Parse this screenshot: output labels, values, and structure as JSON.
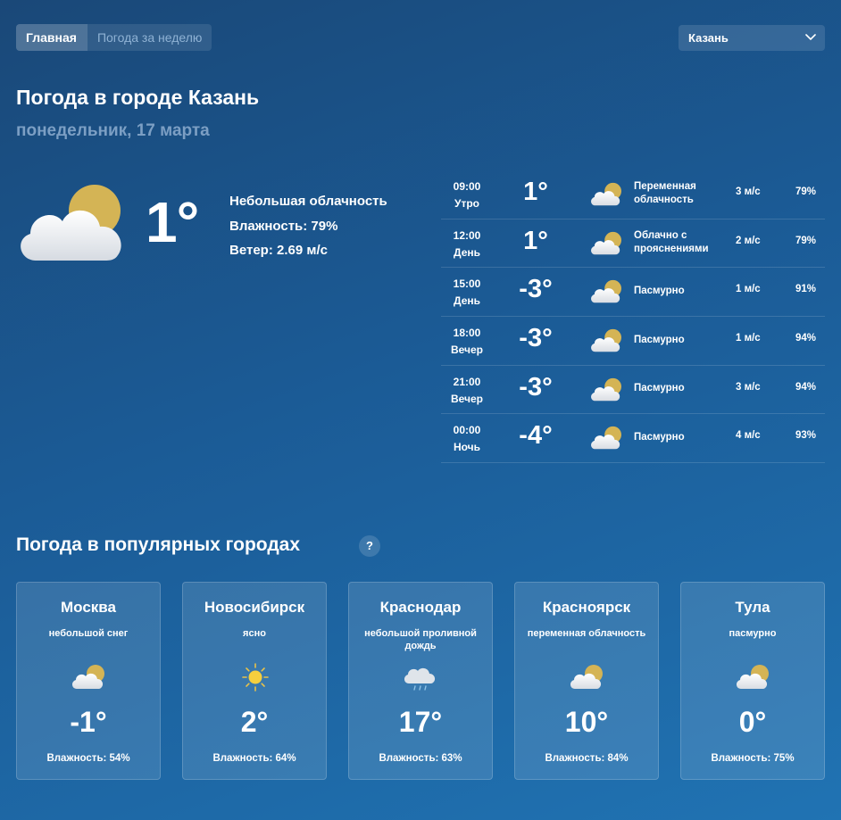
{
  "nav": {
    "tabs": [
      {
        "label": "Главная"
      },
      {
        "label": "Погода за неделю"
      }
    ]
  },
  "city_select": {
    "value": "Казань",
    "icon": "chevron-down-icon"
  },
  "header": {
    "title": "Погода в городе Казань",
    "date": "понедельник, 17 марта"
  },
  "current": {
    "icon": "partly-cloudy-icon",
    "temp": "1°",
    "condition": "Небольшая облачность",
    "humidity": "Влажность: 79%",
    "wind": "Ветер: 2.69 м/с"
  },
  "hourly": [
    {
      "time": "09:00",
      "period": "Утро",
      "temp": "1°",
      "icon": "partly-cloudy-icon",
      "condition": "Переменная облачность",
      "wind": "3 м/с",
      "humidity": "79%"
    },
    {
      "time": "12:00",
      "period": "День",
      "temp": "1°",
      "icon": "partly-cloudy-icon",
      "condition": "Облачно с прояснениями",
      "wind": "2 м/с",
      "humidity": "79%"
    },
    {
      "time": "15:00",
      "period": "День",
      "temp": "-3°",
      "icon": "partly-cloudy-icon",
      "condition": "Пасмурно",
      "wind": "1 м/с",
      "humidity": "91%"
    },
    {
      "time": "18:00",
      "period": "Вечер",
      "temp": "-3°",
      "icon": "partly-cloudy-icon",
      "condition": "Пасмурно",
      "wind": "1 м/с",
      "humidity": "94%"
    },
    {
      "time": "21:00",
      "period": "Вечер",
      "temp": "-3°",
      "icon": "partly-cloudy-icon",
      "condition": "Пасмурно",
      "wind": "3 м/с",
      "humidity": "94%"
    },
    {
      "time": "00:00",
      "period": "Ночь",
      "temp": "-4°",
      "icon": "partly-cloudy-icon",
      "condition": "Пасмурно",
      "wind": "4 м/с",
      "humidity": "93%"
    }
  ],
  "popular": {
    "title": "Погода в популярных городах",
    "help_label": "?",
    "cities": [
      {
        "name": "Москва",
        "condition": "небольшой снег",
        "icon": "partly-cloudy-icon",
        "temp": "-1°",
        "humidity": "Влажность: 54%"
      },
      {
        "name": "Новосибирск",
        "condition": "ясно",
        "icon": "sun-icon",
        "temp": "2°",
        "humidity": "Влажность: 64%"
      },
      {
        "name": "Краснодар",
        "condition": "небольшой проливной дождь",
        "icon": "rain-cloud-icon",
        "temp": "17°",
        "humidity": "Влажность: 63%"
      },
      {
        "name": "Красноярск",
        "condition": "переменная облачность",
        "icon": "partly-cloudy-icon",
        "temp": "10°",
        "humidity": "Влажность: 84%"
      },
      {
        "name": "Тула",
        "condition": "пасмурно",
        "icon": "partly-cloudy-icon",
        "temp": "0°",
        "humidity": "Влажность: 75%"
      }
    ]
  },
  "colors": {
    "sun": "#d4b455",
    "cloud": "#ffffff",
    "subtitle": "#7c9fc4"
  }
}
